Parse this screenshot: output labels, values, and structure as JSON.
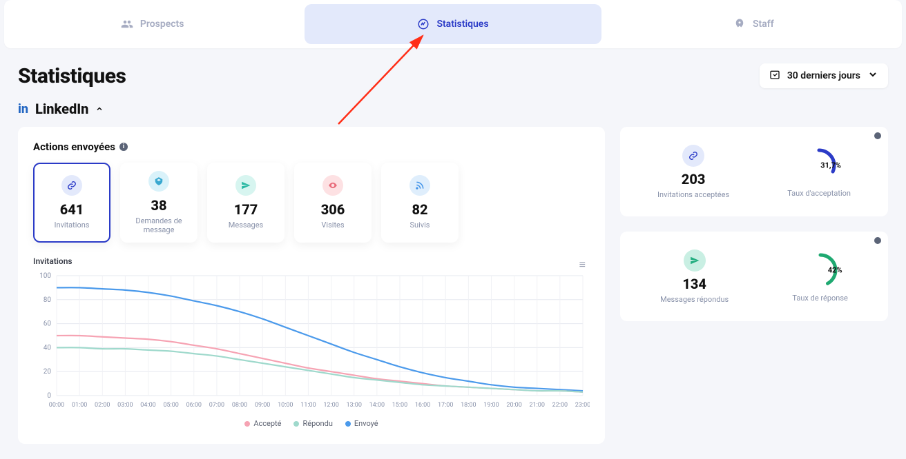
{
  "tabs": {
    "prospects": "Prospects",
    "stats": "Statistiques",
    "staff": "Staff"
  },
  "page": {
    "title": "Statistiques",
    "date_range": "30 derniers jours"
  },
  "section": {
    "platform": "LinkedIn",
    "panel_title": "Actions envoyées"
  },
  "cards": {
    "invitations": {
      "value": "641",
      "label": "Invitations"
    },
    "demandes": {
      "value": "38",
      "label": "Demandes de message"
    },
    "messages": {
      "value": "177",
      "label": "Messages"
    },
    "visites": {
      "value": "306",
      "label": "Visites"
    },
    "suivis": {
      "value": "82",
      "label": "Suivis"
    }
  },
  "chart_data": {
    "type": "line",
    "title": "Invitations",
    "categories": [
      "00:00",
      "01:00",
      "02:00",
      "03:00",
      "04:00",
      "05:00",
      "06:00",
      "07:00",
      "08:00",
      "09:00",
      "10:00",
      "11:00",
      "12:00",
      "13:00",
      "14:00",
      "15:00",
      "16:00",
      "17:00",
      "18:00",
      "19:00",
      "20:00",
      "21:00",
      "22:00",
      "23:00"
    ],
    "ylim": [
      0,
      100
    ],
    "yticks": [
      0,
      20,
      40,
      60,
      80,
      100
    ],
    "series": [
      {
        "name": "Envoyé",
        "color": "#4b9aeb",
        "values": [
          90,
          90,
          89,
          88,
          86,
          83,
          79,
          75,
          70,
          64,
          57,
          50,
          43,
          36,
          30,
          24,
          19,
          15,
          12,
          9,
          7,
          6,
          5,
          4
        ]
      },
      {
        "name": "Accepté",
        "color": "#f6a3b3",
        "values": [
          50,
          50,
          49,
          48,
          47,
          45,
          42,
          39,
          35,
          31,
          27,
          23,
          20,
          17,
          14,
          12,
          10,
          8,
          7,
          6,
          5,
          4,
          4,
          3
        ]
      },
      {
        "name": "Répondu",
        "color": "#9fd9cc",
        "values": [
          40,
          40,
          39,
          39,
          38,
          37,
          35,
          33,
          30,
          27,
          24,
          21,
          18,
          15,
          13,
          11,
          9,
          8,
          7,
          6,
          5,
          4,
          4,
          3
        ]
      }
    ],
    "legend": {
      "accepted": "Accepté",
      "responded": "Répondu",
      "sent": "Envoyé"
    }
  },
  "stats": {
    "accepted_invites": {
      "value": "203",
      "label": "Invitations acceptées"
    },
    "accept_rate": {
      "value": "31,7%",
      "label": "Taux d'acceptation",
      "pct": 31.7,
      "color": "#2b3bc7"
    },
    "msg_responded": {
      "value": "134",
      "label": "Messages répondus"
    },
    "response_rate": {
      "value": "42%",
      "label": "Taux de réponse",
      "pct": 42,
      "color": "#1fa971"
    }
  }
}
